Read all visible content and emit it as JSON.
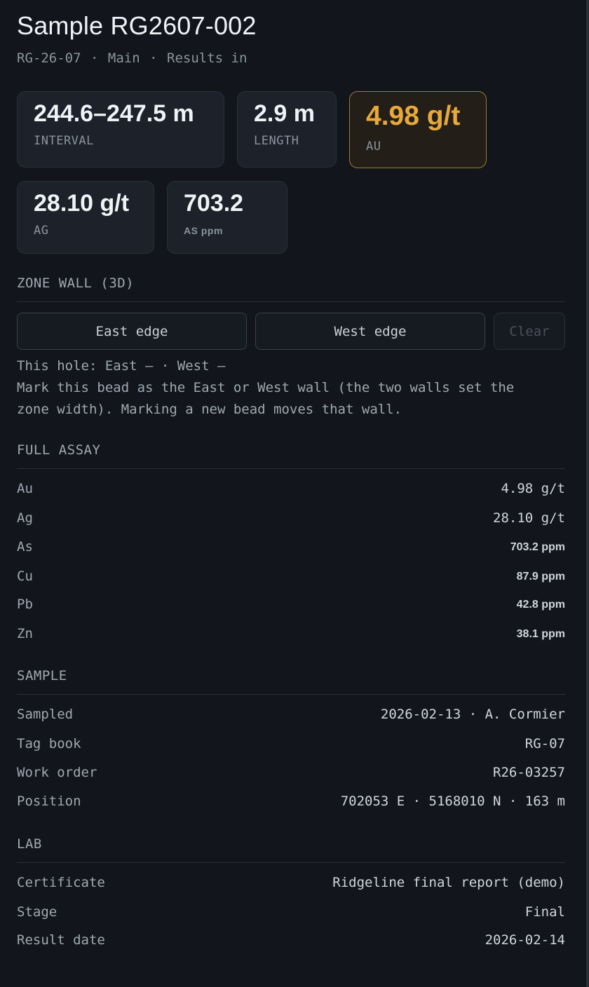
{
  "header": {
    "title": "Sample RG2607-002",
    "hole": "RG-26-07",
    "branch": "Main",
    "status": "Results in",
    "separator": "·"
  },
  "stats": [
    {
      "value": "244.6–247.5 m",
      "label": "INTERVAL"
    },
    {
      "value": "2.9 m",
      "label": "LENGTH"
    },
    {
      "value": "4.98 g/t",
      "label": "AU"
    },
    {
      "value": "28.10 g/t",
      "label": "AG"
    },
    {
      "value": "703.2",
      "label": "AS ppm"
    }
  ],
  "zone_wall": {
    "heading": "ZONE WALL (3D)",
    "east_button": "East edge",
    "west_button": "West edge",
    "clear_button": "Clear",
    "status_line": "This hole: East — · West —",
    "help_line_1": "Mark this bead as the East or West wall (the two walls set the",
    "help_line_2": "zone width). Marking a new bead moves that wall."
  },
  "full_assay": {
    "heading": "FULL ASSAY",
    "rows": [
      {
        "element": "Au",
        "value": "4.98 g/t"
      },
      {
        "element": "Ag",
        "value": "28.10 g/t"
      },
      {
        "element": "As",
        "value": "703.2 ppm"
      },
      {
        "element": "Cu",
        "value": "87.9 ppm"
      },
      {
        "element": "Pb",
        "value": "42.8 ppm"
      },
      {
        "element": "Zn",
        "value": "38.1 ppm"
      }
    ]
  },
  "sample": {
    "heading": "SAMPLE",
    "rows": [
      {
        "key": "Sampled",
        "value": "2026-02-13 · A. Cormier"
      },
      {
        "key": "Tag book",
        "value": "RG-07"
      },
      {
        "key": "Work order",
        "value": "R26-03257"
      },
      {
        "key": "Position",
        "value": "702053 E · 5168010 N · 163 m"
      }
    ]
  },
  "lab": {
    "heading": "LAB",
    "rows": [
      {
        "key": "Certificate",
        "value": "Ridgeline final report (demo)"
      },
      {
        "key": "Stage",
        "value": "Final"
      },
      {
        "key": "Result date",
        "value": "2026-02-14"
      }
    ]
  },
  "colors": {
    "background": "#12151b",
    "card": "#1c212a",
    "accent": "#e8a93a",
    "accent_border": "#a07a2c"
  }
}
